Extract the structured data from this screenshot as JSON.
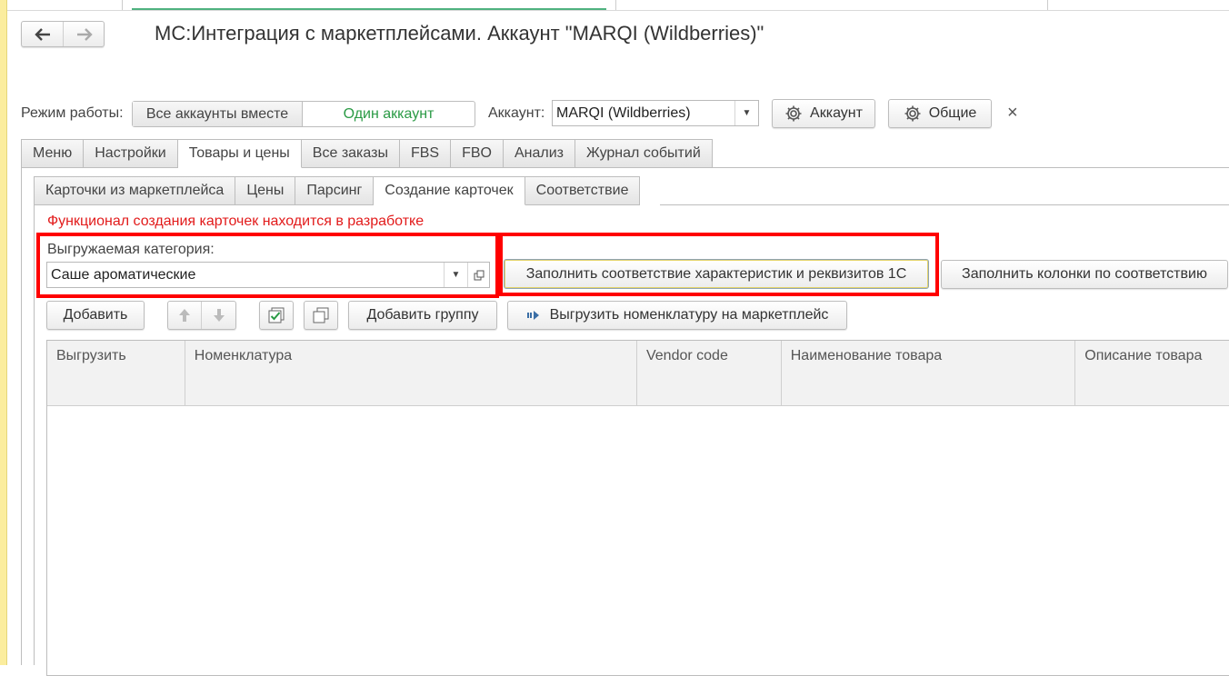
{
  "window": {
    "title": "МС:Интеграция с маркетплейсами. Аккаунт \"MARQI (Wildberries)\""
  },
  "mode": {
    "label": "Режим работы:",
    "options": [
      "Все аккаунты вместе",
      "Один аккаунт"
    ],
    "selected": "Один аккаунт"
  },
  "account": {
    "label": "Аккаунт:",
    "value": "MARQI (Wildberries)",
    "account_button": "Аккаунт",
    "general_button": "Общие",
    "close_symbol": "×"
  },
  "main_tabs": [
    {
      "label": "Меню"
    },
    {
      "label": "Настройки"
    },
    {
      "label": "Товары и цены",
      "active": true
    },
    {
      "label": "Все заказы"
    },
    {
      "label": "FBS"
    },
    {
      "label": "FBO"
    },
    {
      "label": "Анализ"
    },
    {
      "label": "Журнал событий"
    }
  ],
  "sub_tabs": [
    {
      "label": "Карточки из маркетплейса"
    },
    {
      "label": "Цены"
    },
    {
      "label": "Парсинг"
    },
    {
      "label": "Создание карточек",
      "active": true
    },
    {
      "label": "Соответствие"
    }
  ],
  "warning": "Функционал создания карточек находится в разработке",
  "category": {
    "label": "Выгружаемая категория:",
    "value": "Саше ароматические"
  },
  "actions": {
    "fill_match": "Заполнить соответствие характеристик и реквизитов 1С",
    "fill_columns": "Заполнить колонки по соответствию"
  },
  "toolbar": {
    "add": "Добавить",
    "add_group": "Добавить группу",
    "upload": "Выгрузить номенклатуру на маркетплейс"
  },
  "table": {
    "columns": [
      "Выгрузить",
      "Номенклатура",
      "Vendor code",
      "Наименование товара",
      "Описание товара"
    ]
  },
  "colors": {
    "accent_green": "#2a9a45",
    "warning_red": "#e21b1b",
    "highlight_red": "#ff0000",
    "side_bar_yellow": "#fbed9e"
  }
}
